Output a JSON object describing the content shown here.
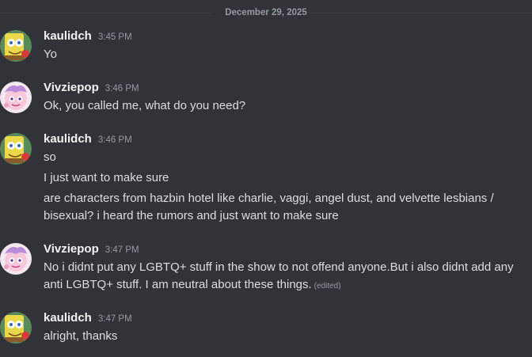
{
  "date_divider": "December 29, 2025",
  "messages": [
    {
      "username": "kaulidch",
      "time": "3:45 PM",
      "avatar": "spongebob-avatar",
      "lines": [
        "Yo"
      ]
    },
    {
      "username": "Vivziepop",
      "time": "3:46 PM",
      "avatar": "vivziepop-avatar",
      "lines": [
        "Ok, you called me, what do you need?"
      ]
    },
    {
      "username": "kaulidch",
      "time": "3:46 PM",
      "avatar": "spongebob-avatar",
      "lines": [
        "so",
        "I just want to make sure",
        "are characters from hazbin hotel like charlie, vaggi, angel dust, and velvette lesbians / bisexual? i heard the rumors and just want to make sure"
      ]
    },
    {
      "username": "Vivziepop",
      "time": "3:47 PM",
      "avatar": "vivziepop-avatar",
      "lines": [
        "No i didnt put any LGBTQ+ stuff in the show to not offend anyone.But i also didnt add any anti LGBTQ+ stuff. I am neutral about these things."
      ],
      "edited_label": "(edited)"
    },
    {
      "username": "kaulidch",
      "time": "3:47 PM",
      "avatar": "spongebob-avatar",
      "lines": [
        "alright, thanks"
      ]
    }
  ]
}
